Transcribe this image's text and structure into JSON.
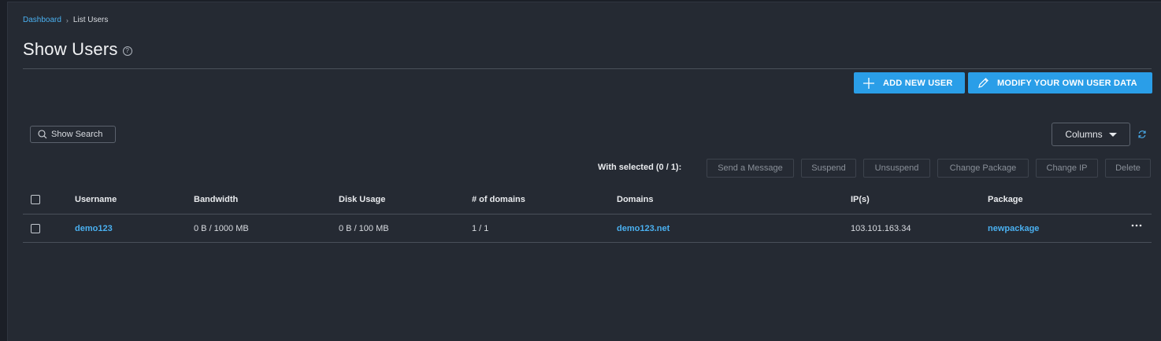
{
  "breadcrumb": {
    "home": "Dashboard",
    "current": "List Users"
  },
  "page": {
    "title": "Show Users",
    "help_glyph": "?"
  },
  "buttons": {
    "add_user": "ADD NEW USER",
    "modify_user": "MODIFY YOUR OWN USER DATA",
    "show_search": "Show Search",
    "columns": "Columns"
  },
  "bulk": {
    "label": "With selected (0 / 1):",
    "actions": [
      "Send a Message",
      "Suspend",
      "Unsuspend",
      "Change Package",
      "Change IP",
      "Delete"
    ]
  },
  "table": {
    "headers": [
      "Username",
      "Bandwidth",
      "Disk Usage",
      "# of domains",
      "Domains",
      "IP(s)",
      "Package"
    ],
    "rows": [
      {
        "username": "demo123",
        "bandwidth": "0 B / 1000 MB",
        "disk": "0 B / 100 MB",
        "domain_count": "1 / 1",
        "domains": "demo123.net",
        "ip": "103.101.163.34",
        "package": "newpackage"
      }
    ]
  },
  "colors": {
    "accent": "#2a9ee8",
    "link": "#4ab0f0",
    "background": "#252a33"
  }
}
